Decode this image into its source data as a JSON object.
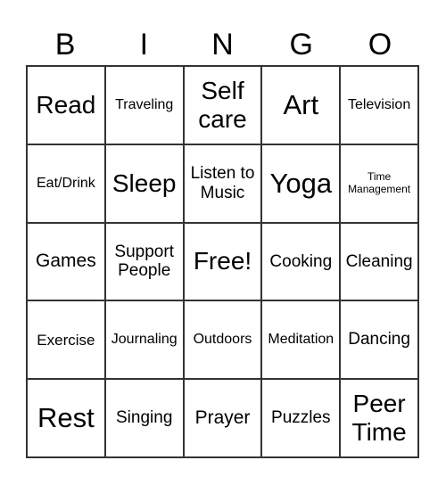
{
  "header": [
    "B",
    "I",
    "N",
    "G",
    "O"
  ],
  "cells": [
    {
      "text": "Read",
      "size": "s-l"
    },
    {
      "text": "Traveling",
      "size": "s-t"
    },
    {
      "text": "Self care",
      "size": "s-l"
    },
    {
      "text": "Art",
      "size": "s-xl"
    },
    {
      "text": "Television",
      "size": "s-t"
    },
    {
      "text": "Eat/Drink",
      "size": "s-t"
    },
    {
      "text": "Sleep",
      "size": "s-l"
    },
    {
      "text": "Listen to Music",
      "size": "s-s"
    },
    {
      "text": "Yoga",
      "size": "s-xl"
    },
    {
      "text": "Time Management",
      "size": "s-xxs"
    },
    {
      "text": "Games",
      "size": "s-m"
    },
    {
      "text": "Support People",
      "size": "s-s"
    },
    {
      "text": "Free!",
      "size": "s-l"
    },
    {
      "text": "Cooking",
      "size": "s-s"
    },
    {
      "text": "Cleaning",
      "size": "s-s"
    },
    {
      "text": "Exercise",
      "size": "s-xs"
    },
    {
      "text": "Journaling",
      "size": "s-t"
    },
    {
      "text": "Outdoors",
      "size": "s-t"
    },
    {
      "text": "Meditation",
      "size": "s-t"
    },
    {
      "text": "Dancing",
      "size": "s-s"
    },
    {
      "text": "Rest",
      "size": "s-xl"
    },
    {
      "text": "Singing",
      "size": "s-s"
    },
    {
      "text": "Prayer",
      "size": "s-m"
    },
    {
      "text": "Puzzles",
      "size": "s-s"
    },
    {
      "text": "Peer Time",
      "size": "s-l"
    }
  ]
}
